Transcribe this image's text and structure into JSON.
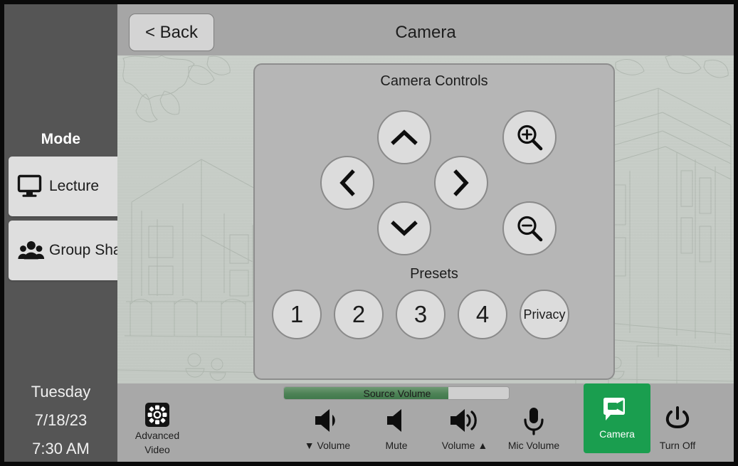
{
  "header": {
    "back_label": "< Back",
    "title": "Camera"
  },
  "sidebar": {
    "mode_heading": "Mode",
    "items": [
      {
        "label": "Lecture",
        "icon": "monitor-icon",
        "selected": true
      },
      {
        "label": "Group Share",
        "icon": "group-people-icon",
        "selected": false
      }
    ],
    "clock": {
      "weekday": "Tuesday",
      "date": "7/18/23",
      "time": "7:30 AM"
    }
  },
  "camera_panel": {
    "controls_title": "Camera Controls",
    "presets_title": "Presets",
    "pad": [
      {
        "name": "tilt-up",
        "icon": "chevron-up-icon"
      },
      {
        "name": "tilt-down",
        "icon": "chevron-down-icon"
      },
      {
        "name": "pan-left",
        "icon": "chevron-left-icon"
      },
      {
        "name": "pan-right",
        "icon": "chevron-right-icon"
      },
      {
        "name": "zoom-in",
        "icon": "magnifier-plus-icon"
      },
      {
        "name": "zoom-out",
        "icon": "magnifier-minus-icon"
      }
    ],
    "presets": [
      {
        "label": "1"
      },
      {
        "label": "2"
      },
      {
        "label": "3"
      },
      {
        "label": "4"
      },
      {
        "label": "Privacy"
      }
    ]
  },
  "bottom_bar": {
    "source_volume": {
      "label": "Source Volume",
      "level_percent": 73
    },
    "tools": [
      {
        "id": "advanced-video",
        "line1": "Advanced",
        "line2": "Video",
        "icon": "gear-square-icon"
      },
      {
        "id": "volume-down",
        "line1": "▼ Volume",
        "line2": "",
        "icon": "speaker-low-icon"
      },
      {
        "id": "mute",
        "line1": "Mute",
        "line2": "",
        "icon": "speaker-mute-icon"
      },
      {
        "id": "volume-up",
        "line1": "Volume ▲",
        "line2": "",
        "icon": "speaker-high-icon"
      },
      {
        "id": "mic-volume",
        "line1": "Mic Volume",
        "line2": "",
        "icon": "microphone-icon"
      },
      {
        "id": "camera",
        "line1": "Camera",
        "line2": "",
        "icon": "video-chat-icon",
        "active": true
      },
      {
        "id": "turn-off",
        "line1": "Turn Off",
        "line2": "",
        "icon": "power-icon"
      }
    ]
  },
  "colors": {
    "bezel": "#0a0a0a",
    "sidebar": "#555555",
    "stage": "#a8a8a8",
    "card": "#b6b6b6",
    "button_face": "#dcdcdc",
    "accent_green": "#1a9e4f",
    "volume_green": "#4d8256",
    "text_dark": "#1c1c1c",
    "text_light": "#f0f0f0"
  }
}
